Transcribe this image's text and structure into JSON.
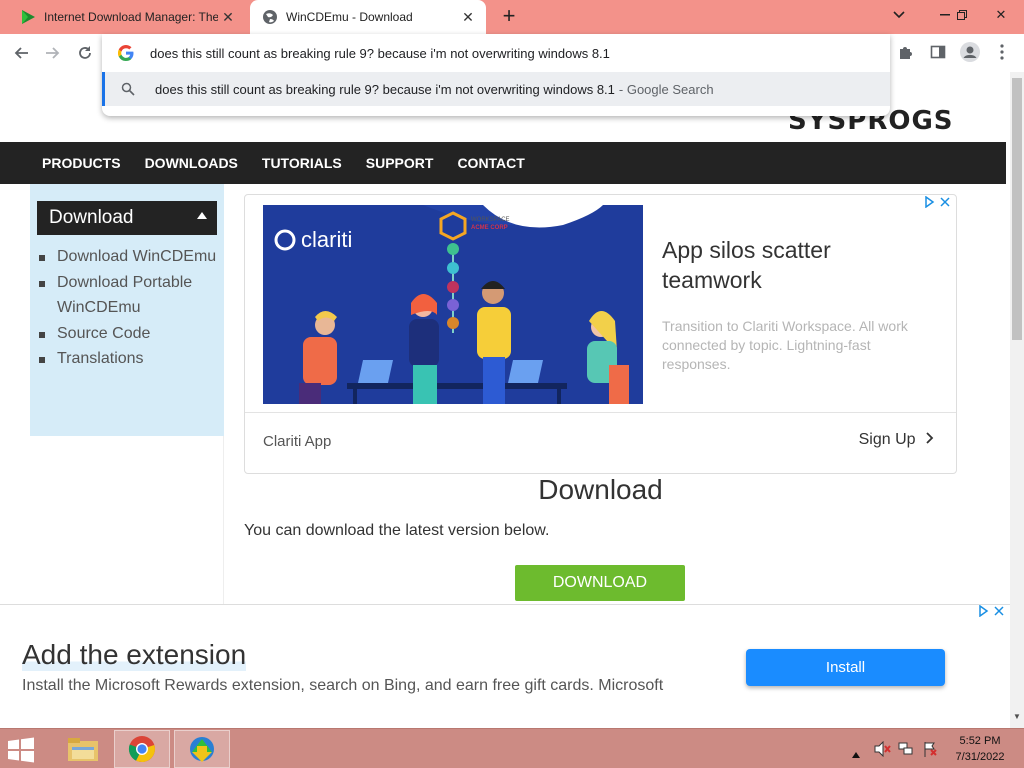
{
  "browser": {
    "tabs": [
      {
        "title": "Internet Download Manager: The"
      },
      {
        "title": "WinCDEmu - Download"
      }
    ],
    "omnibox": {
      "text": "does this still count as breaking rule 9? because i'm not overwriting windows 8.1",
      "suggestion": "does this still count as breaking rule 9? because i'm not overwriting windows 8.1",
      "suggestion_suffix": "- Google Search"
    }
  },
  "site": {
    "logo": "SYSPROGS",
    "nav": [
      "PRODUCTS",
      "DOWNLOADS",
      "TUTORIALS",
      "SUPPORT",
      "CONTACT"
    ],
    "sidebar": {
      "header": "Download",
      "items": [
        "Download WinCDEmu",
        "Download Portable WinCDEmu",
        "Source Code",
        "Translations"
      ]
    },
    "ad": {
      "brand": "clariti",
      "badge_line1": "WORKSPACE",
      "badge_line2": "ACME CORP",
      "headline": "App silos scatter teamwork",
      "body": "Transition to Clariti Workspace. All work connected by topic. Lightning-fast responses.",
      "advertiser": "Clariti App",
      "cta": "Sign Up"
    },
    "main": {
      "title": "Download",
      "description": "You can download the latest version below.",
      "button": "DOWNLOAD"
    },
    "bottom_ad": {
      "title": "Add the extension",
      "text": "Install the Microsoft Rewards extension, search on Bing, and earn free gift cards. Microsoft",
      "button": "Install"
    }
  },
  "taskbar": {
    "time": "5:52 PM",
    "date": "7/31/2022"
  }
}
